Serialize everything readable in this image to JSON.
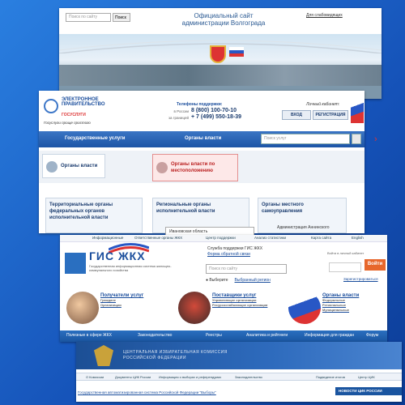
{
  "volgograd": {
    "search_placeholder": "Поиск по сайту",
    "search_button": "Поиск",
    "title": "Официальный сайт администрации Волгограда",
    "visually_impaired": "Для слабовидящих"
  },
  "gosuslugi": {
    "logo_text": "ЭЛЕКТРОННОЕ ПРАВИТЕЛЬСТВО",
    "logo_sub": "ГОСУСЛУГИ",
    "slogan": "Госуслуги проще простого",
    "phones_label": "Телефоны поддержки:",
    "phone_ru_label": "в России",
    "phone_abroad_label": "за границей",
    "phone_ru": "8 (800) 100-70-10",
    "phone_abroad": "+ 7 (499) 550-18-39",
    "cabinet_label": "Личный кабинет:",
    "login_button": "ВХОД",
    "register_button": "РЕГИСТРАЦИЯ",
    "nav": {
      "services": "Государственные услуги",
      "authorities": "Органы власти"
    },
    "search_placeholder": "Поиск услуг",
    "tab_authorities": "Органы власти",
    "tab_by_location": "Органы власти по местоположению",
    "box_federal": "Территориальные органы федеральных органов исполнительной власти",
    "box_regional": "Региональные органы исполнительной власти",
    "box_local": "Органы местного самоуправления",
    "region_select": "Ивановская область",
    "admin_item": "Администрация Аннинского"
  },
  "gis": {
    "topbar": [
      "Информационные",
      "Ответственные органы ЖКХ",
      "Центр поддержки",
      "Анализ статистики",
      "Карта сайта",
      "English"
    ],
    "title": "ГИС ЖКХ",
    "description": "Государственная информационная система жилищно-коммунального хозяйства",
    "support_label": "Служба поддержки ГИС ЖКХ",
    "support_link": "Форма обратной связи",
    "search_placeholder": "Поиск по сайту",
    "location_label": "Выберите",
    "location_link": "Выбранный регион",
    "login_hint": "Войти в личный кабинет",
    "login_button": "Войти",
    "register_link": "Зарегистрироваться",
    "categories": [
      {
        "title": "Получатели услуг",
        "items": [
          "Граждане",
          "Организации"
        ]
      },
      {
        "title": "Поставщики услуг",
        "items": [
          "Управляющие организации",
          "Ресурсоснабжающие организации"
        ]
      },
      {
        "title": "Органы власти",
        "items": [
          "Федеральные",
          "Региональные",
          "Муниципальные"
        ]
      }
    ],
    "menu": [
      "Полезные в сфере ЖКХ",
      "Законодательство",
      "Реестры",
      "Аналитика и рейтинги",
      "Информация для граждан",
      "Форум"
    ]
  },
  "izbirkom": {
    "title_line1": "ЦЕНТРАЛЬНАЯ ИЗБИРАТЕЛЬНАЯ КОМИССИЯ",
    "title_line2": "РОССИЙСКОЙ ФЕДЕРАЦИИ",
    "nav": [
      "О Комиссии",
      "Документы ЦИК России",
      "Информация о выборах и референдумах",
      "Законодательство",
      "Подведение итогов",
      "Центр ЦИК"
    ],
    "footer_link": "Государственная автоматизированная система Российской Федерации \"Выборы\"",
    "news_label": "НОВОСТИ ЦИК РОССИИ"
  }
}
